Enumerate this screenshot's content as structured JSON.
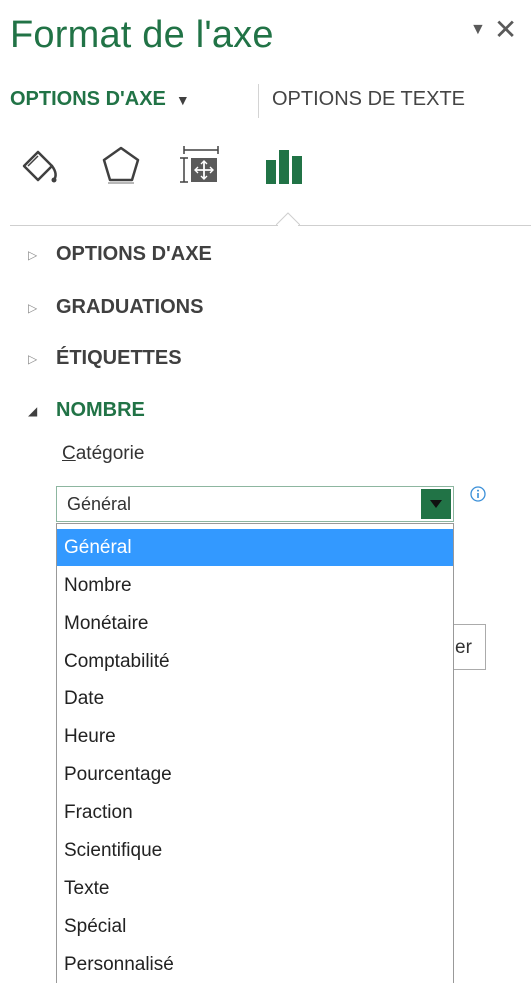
{
  "panel": {
    "title": "Format de l'axe",
    "dropdown_icon": "chevron-down-icon",
    "close_icon": "close-icon"
  },
  "tabs": [
    {
      "label": "OPTIONS D'AXE",
      "active": true
    },
    {
      "label": "OPTIONS DE TEXTE",
      "active": false
    }
  ],
  "icon_tabs": [
    "fill-line-icon",
    "effects-icon",
    "size-properties-icon",
    "axis-options-icon"
  ],
  "sections": [
    {
      "label": "OPTIONS D'AXE",
      "expanded": false
    },
    {
      "label": "GRADUATIONS",
      "expanded": false
    },
    {
      "label": "ÉTIQUETTES",
      "expanded": false
    },
    {
      "label": "NOMBRE",
      "expanded": true
    }
  ],
  "number": {
    "category_label_access_key": "C",
    "category_label_rest": "atégorie",
    "selected_value": "Général",
    "options": [
      "Général",
      "Nombre",
      "Monétaire",
      "Comptabilité",
      "Date",
      "Heure",
      "Pourcentage",
      "Fraction",
      "Scientifique",
      "Texte",
      "Spécial",
      "Personnalisé"
    ],
    "highlighted_index": 0,
    "partial_button_text": "er"
  },
  "colors": {
    "accent": "#217346",
    "highlight": "#3399ff"
  }
}
